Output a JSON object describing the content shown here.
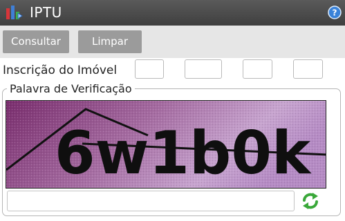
{
  "header": {
    "title": "IPTU",
    "app_icon": "bar-chart-app-icon",
    "help_icon": "help-question-icon",
    "bar_color": "#4a4a4a"
  },
  "toolbar": {
    "consultar_label": "Consultar",
    "limpar_label": "Limpar",
    "button_color": "#9b9b9b"
  },
  "inscricao": {
    "label": "Inscrição do Imóvel",
    "fields": [
      "",
      "",
      "",
      ""
    ]
  },
  "verificacao": {
    "legend": "Palavra de Verificação",
    "captcha_text": "6w1b0k",
    "input_value": "",
    "refresh_icon": "refresh-arrows-icon",
    "refresh_color": "#3aa83a"
  }
}
